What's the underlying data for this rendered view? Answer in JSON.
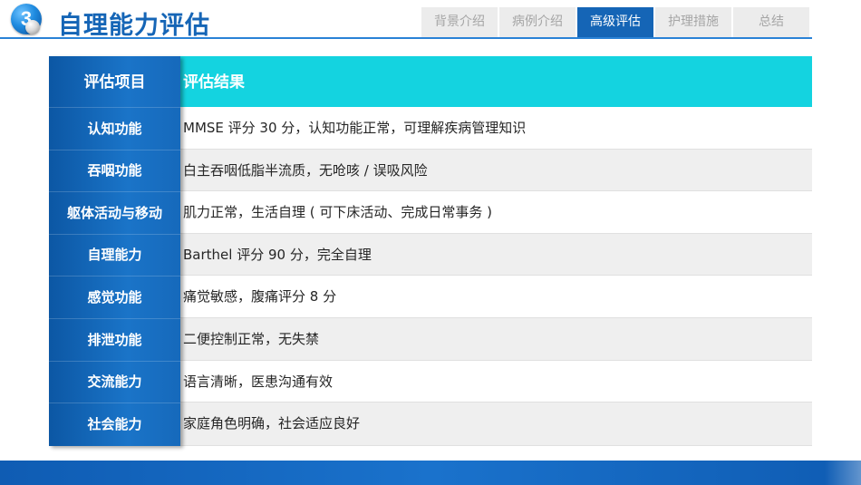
{
  "header": {
    "badge_number": "3",
    "title": "自理能力评估",
    "tabs": [
      {
        "label": "背景介绍",
        "active": false
      },
      {
        "label": "病例介绍",
        "active": false
      },
      {
        "label": "高级评估",
        "active": true
      },
      {
        "label": "护理措施",
        "active": false
      },
      {
        "label": "总结",
        "active": false
      }
    ]
  },
  "table": {
    "headers": [
      "评估项目",
      "评估结果"
    ],
    "rows": [
      {
        "item": "认知功能",
        "result": "MMSE 评分 30 分，认知功能正常，可理解疾病管理知识"
      },
      {
        "item": "吞咽功能",
        "result": "白主吞咽低脂半流质，无呛咳 / 误吸风险"
      },
      {
        "item": "躯体活动与移动",
        "result": "肌力正常，生活自理 ( 可下床活动、完成日常事务 )"
      },
      {
        "item": "自理能力",
        "result": "Barthel 评分 90 分，完全自理"
      },
      {
        "item": "感觉功能",
        "result": "痛觉敏感，腹痛评分 8 分"
      },
      {
        "item": "排泄功能",
        "result": "二便控制正常，无失禁"
      },
      {
        "item": "交流能力",
        "result": "语言清晰，医患沟通有效"
      },
      {
        "item": "社会能力",
        "result": "家庭角色明确，社会适应良好"
      }
    ]
  },
  "colors": {
    "primary_blue": "#1565b6",
    "header_cyan": "#14d3e0",
    "row_alt": "#efefef",
    "tab_inactive": "#ececec"
  }
}
